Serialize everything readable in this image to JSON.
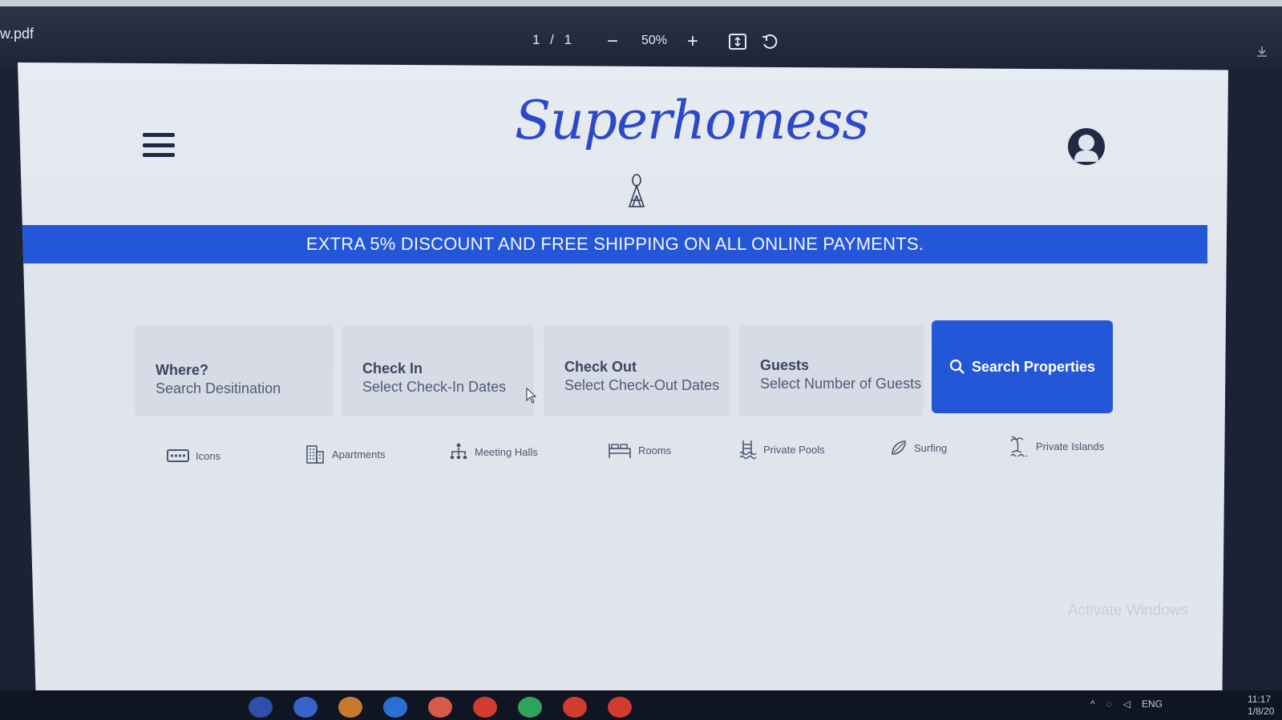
{
  "viewer": {
    "file_name": "w.pdf",
    "page_indicator": "1 / 1",
    "zoom": "50%",
    "zoom_out_glyph": "−",
    "zoom_in_glyph": "+",
    "icons": [
      "minus-icon",
      "plus-icon",
      "fit-page-icon",
      "rotate-icon",
      "download-icon"
    ]
  },
  "site": {
    "logo_text": "Superhomess",
    "promo_banner": "EXTRA 5% DISCOUNT AND FREE SHIPPING ON ALL ONLINE PAYMENTS.",
    "accent_color": "#2456d8",
    "search": {
      "where_label": "Where?",
      "where_hint": "Search Desitination",
      "checkin_label": "Check In",
      "checkin_hint": "Select Check-In Dates",
      "checkout_label": "Check Out",
      "checkout_hint": "Select Check-Out Dates",
      "guests_label": "Guests",
      "guests_hint": "Select Number of Guests",
      "button_label": "Search Properties"
    },
    "categories": [
      {
        "label": "Icons",
        "icon": "ticket-icon"
      },
      {
        "label": "Apartments",
        "icon": "building-icon"
      },
      {
        "label": "Meeting Halls",
        "icon": "hierarchy-icon"
      },
      {
        "label": "Rooms",
        "icon": "bed-icon"
      },
      {
        "label": "Private Pools",
        "icon": "pool-icon"
      },
      {
        "label": "Surfing",
        "icon": "surfboard-icon"
      },
      {
        "label": "Private Islands",
        "icon": "island-icon"
      }
    ]
  },
  "os": {
    "watermark": "Activate Windows",
    "tray_lang": "ENG",
    "clock_time": "11:17",
    "clock_date": "1/8/20"
  }
}
